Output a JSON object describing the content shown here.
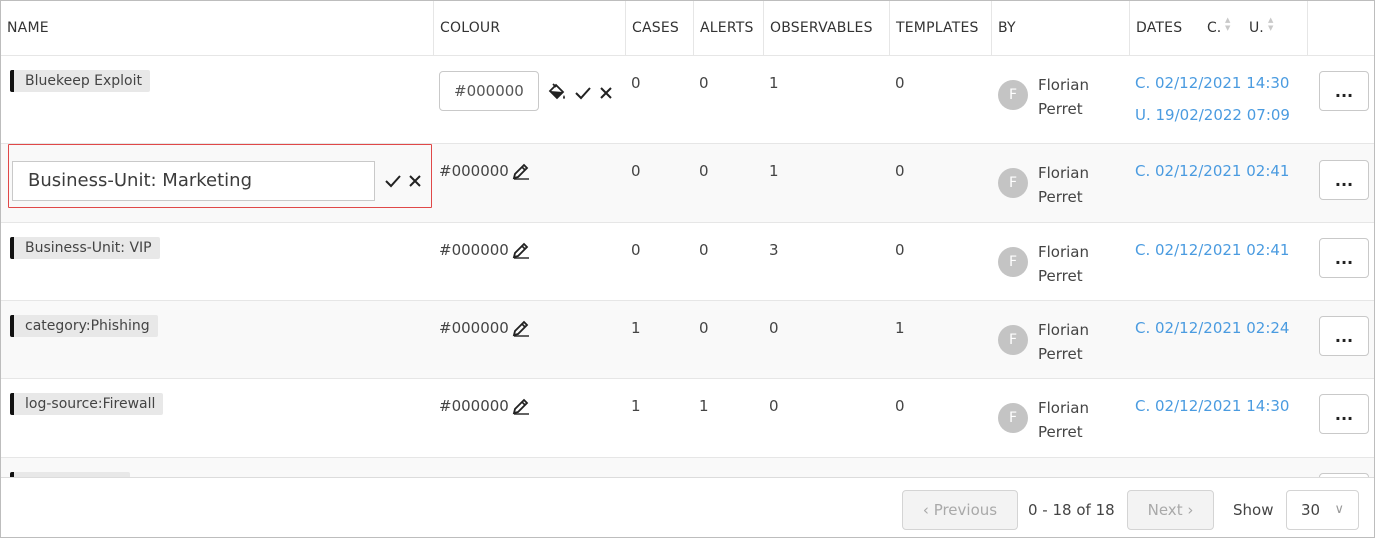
{
  "columns": {
    "name": "NAME",
    "colour": "COLOUR",
    "cases": "CASES",
    "alerts": "ALERTS",
    "observables": "OBSERVABLES",
    "templates": "TEMPLATES",
    "by": "BY",
    "dates": "DATES",
    "sort_created": "C.",
    "sort_updated": "U."
  },
  "rows": [
    {
      "name": "Bluekeep Exploit",
      "colour": "#000000",
      "cases": "0",
      "alerts": "0",
      "observables": "1",
      "templates": "0",
      "avatar": "F",
      "by_first": "Florian",
      "by_last": "Perret",
      "created": "C. 02/12/2021 14:30",
      "updated": "U. 19/02/2022 07:09",
      "editing": "colour"
    },
    {
      "name": "Business-Unit: Marketing",
      "colour": "#000000",
      "cases": "0",
      "alerts": "0",
      "observables": "1",
      "templates": "0",
      "avatar": "F",
      "by_first": "Florian",
      "by_last": "Perret",
      "created": "C. 02/12/2021 02:41",
      "editing": "name"
    },
    {
      "name": "Business-Unit: VIP",
      "colour": "#000000",
      "cases": "0",
      "alerts": "0",
      "observables": "3",
      "templates": "0",
      "avatar": "F",
      "by_first": "Florian",
      "by_last": "Perret",
      "created": "C. 02/12/2021 02:41"
    },
    {
      "name": "category:Phishing",
      "colour": "#000000",
      "cases": "1",
      "alerts": "0",
      "observables": "0",
      "templates": "1",
      "avatar": "F",
      "by_first": "Florian",
      "by_last": "Perret",
      "created": "C. 02/12/2021 02:24"
    },
    {
      "name": "log-source:Firewall",
      "colour": "#000000",
      "cases": "1",
      "alerts": "1",
      "observables": "0",
      "templates": "0",
      "avatar": "F",
      "by_first": "Florian",
      "by_last": "Perret",
      "created": "C. 02/12/2021 14:30"
    }
  ],
  "actions_label": "...",
  "colour_editor": {
    "value": "#000000",
    "fill_icon": "paint-bucket-icon"
  },
  "pagination": {
    "previous": "Previous",
    "next": "Next",
    "range": "0 - 18 of 18",
    "show_label": "Show",
    "page_size": "30"
  },
  "colors": {
    "link": "#4a9be0",
    "tag_bg": "#e8e8e8",
    "tag_color": "#000000",
    "edit_border": "#e04848"
  }
}
